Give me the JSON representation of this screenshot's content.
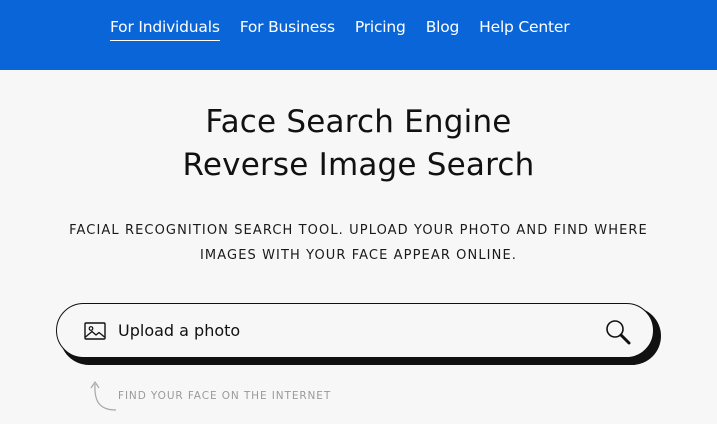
{
  "nav": {
    "items": [
      {
        "label": "For Individuals",
        "active": true
      },
      {
        "label": "For Business"
      },
      {
        "label": "Pricing"
      },
      {
        "label": "Blog"
      },
      {
        "label": "Help Center"
      }
    ]
  },
  "hero": {
    "title_line1": "Face Search Engine",
    "title_line2": "Reverse Image Search",
    "subtitle_line1": "FACIAL RECOGNITION SEARCH TOOL. UPLOAD YOUR PHOTO AND FIND WHERE",
    "subtitle_line2": "IMAGES WITH YOUR FACE APPEAR ONLINE."
  },
  "search": {
    "upload_label": "Upload a photo",
    "hint": "FIND YOUR FACE ON THE INTERNET"
  },
  "colors": {
    "header_bg": "#0a66d8",
    "page_bg": "#f7f7f7",
    "text": "#111111",
    "hint_text": "#9a9a9a"
  },
  "icons": {
    "image": "image-icon",
    "search": "search-icon",
    "arrow": "curved-arrow-icon"
  }
}
